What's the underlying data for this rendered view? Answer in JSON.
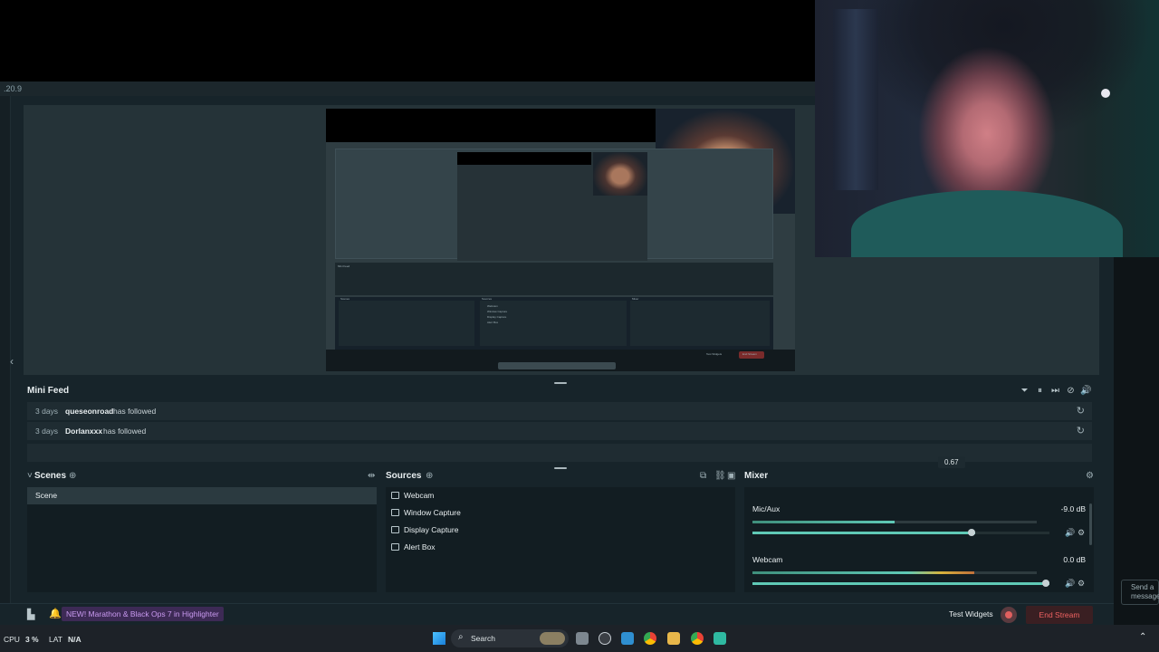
{
  "app": {
    "version": ".20.9"
  },
  "preview": {
    "mini_labels": [
      "Mini Feed",
      "Scenes",
      "Sources",
      "Mixer",
      "Webcam",
      "Window Capture",
      "Display Capture",
      "Alert Box",
      "Test Widgets",
      "End Stream"
    ]
  },
  "mini_feed": {
    "title": "Mini Feed",
    "items": [
      {
        "time": "3 days",
        "user": "queseonroad",
        "action": "has followed"
      },
      {
        "time": "3 days",
        "user": "Dorlanxxx",
        "action": "has followed"
      }
    ]
  },
  "scenes": {
    "title": "Scenes",
    "items": [
      "Scene"
    ]
  },
  "sources": {
    "title": "Sources",
    "items": [
      "Webcam",
      "Window Capture",
      "Display Capture",
      "Alert Box"
    ]
  },
  "mixer": {
    "title": "Mixer",
    "tooltip": "0.67",
    "channels": [
      {
        "name": "Mic/Aux",
        "db": "-9.0 dB",
        "meter_level": 0.5,
        "fader_level": 0.75
      },
      {
        "name": "Webcam",
        "db": "0.0 dB",
        "meter_level": 0.78,
        "fader_level": 1.0
      }
    ]
  },
  "footer": {
    "promo": "NEW! Marathon & Black Ops 7 in Highlighter",
    "test_widgets": "Test Widgets",
    "end_stream": "End Stream"
  },
  "chat": {
    "send_placeholder": "Send a message"
  },
  "taskbar": {
    "cpu_label": "CPU",
    "cpu_value": "3 %",
    "lat_label": "LAT",
    "lat_value": "N/A",
    "search_label": "Search"
  },
  "icons": {
    "filter": "filter-icon",
    "pause": "pause-icon",
    "skip": "skip-icon",
    "mute": "mute-icon",
    "volume": "volume-icon",
    "replay": "replay-icon",
    "gear": "gear-icon",
    "add": "add-icon"
  },
  "colors": {
    "accent": "#5fc9b6",
    "danger": "#f06262",
    "promo": "#c99af0"
  }
}
